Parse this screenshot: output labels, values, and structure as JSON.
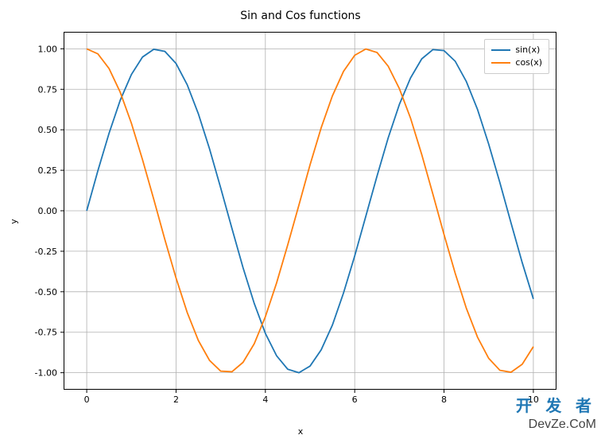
{
  "chart_data": {
    "type": "line",
    "title": "Sin and Cos functions",
    "xlabel": "x",
    "ylabel": "y",
    "xlim": [
      -0.5,
      10.5
    ],
    "ylim": [
      -1.1,
      1.1
    ],
    "x_ticks": [
      0,
      2,
      4,
      6,
      8,
      10
    ],
    "y_ticks": [
      -1.0,
      -0.75,
      -0.5,
      -0.25,
      0.0,
      0.25,
      0.5,
      0.75,
      1.0
    ],
    "x": [
      0.0,
      0.25,
      0.5,
      0.75,
      1.0,
      1.25,
      1.5,
      1.75,
      2.0,
      2.25,
      2.5,
      2.75,
      3.0,
      3.25,
      3.5,
      3.75,
      4.0,
      4.25,
      4.5,
      4.75,
      5.0,
      5.25,
      5.5,
      5.75,
      6.0,
      6.25,
      6.5,
      6.75,
      7.0,
      7.25,
      7.5,
      7.75,
      8.0,
      8.25,
      8.5,
      8.75,
      9.0,
      9.25,
      9.5,
      9.75,
      10.0
    ],
    "series": [
      {
        "name": "sin(x)",
        "color": "#1f77b4",
        "values": [
          0.0,
          0.247,
          0.479,
          0.682,
          0.841,
          0.949,
          0.997,
          0.984,
          0.909,
          0.778,
          0.599,
          0.382,
          0.141,
          -0.108,
          -0.351,
          -0.572,
          -0.757,
          -0.895,
          -0.978,
          -1.0,
          -0.959,
          -0.859,
          -0.706,
          -0.508,
          -0.279,
          -0.033,
          0.215,
          0.45,
          0.657,
          0.82,
          0.938,
          0.995,
          0.989,
          0.923,
          0.798,
          0.625,
          0.412,
          0.174,
          -0.075,
          -0.32,
          -0.544
        ]
      },
      {
        "name": "cos(x)",
        "color": "#ff7f0e",
        "values": [
          1.0,
          0.969,
          0.878,
          0.732,
          0.54,
          0.315,
          0.071,
          -0.178,
          -0.416,
          -0.628,
          -0.801,
          -0.924,
          -0.99,
          -0.994,
          -0.936,
          -0.821,
          -0.654,
          -0.446,
          -0.211,
          0.035,
          0.284,
          0.512,
          0.709,
          0.861,
          0.96,
          0.999,
          0.977,
          0.893,
          0.754,
          0.572,
          0.347,
          0.103,
          -0.146,
          -0.386,
          -0.602,
          -0.781,
          -0.911,
          -0.985,
          -0.997,
          -0.948,
          -0.839
        ]
      }
    ],
    "legend_position": "upper right"
  },
  "watermark": {
    "main": "开 发 者",
    "sub": "DevZe.CoM"
  }
}
